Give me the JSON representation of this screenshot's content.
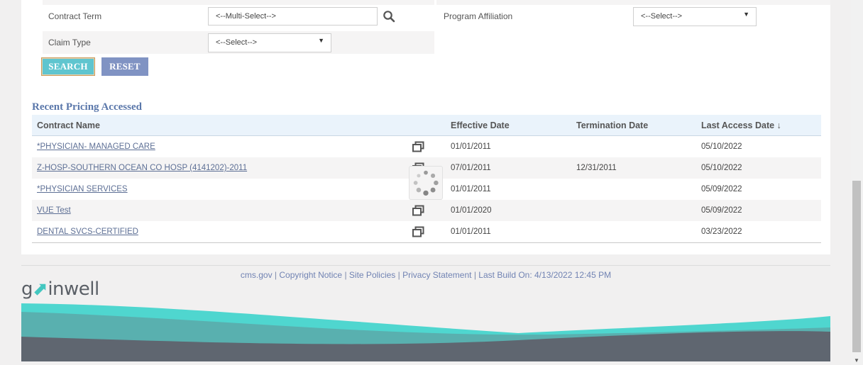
{
  "form": {
    "contract_term_label": "Contract Term",
    "contract_term_placeholder": "<--Multi-Select-->",
    "program_affiliation_label": "Program Affiliation",
    "program_affiliation_value": "<--Select-->",
    "claim_type_label": "Claim Type",
    "claim_type_value": "<--Select-->",
    "search_button": "SEARCH",
    "reset_button": "RESET"
  },
  "recent": {
    "title": "Recent Pricing Accessed",
    "headers": {
      "contract_name": "Contract Name",
      "effective_date": "Effective Date",
      "termination_date": "Termination Date",
      "last_access_date": "Last Access Date ↓"
    },
    "rows": [
      {
        "contract_name": "*PHYSICIAN- MANAGED CARE",
        "effective_date": "01/01/2011",
        "termination_date": "",
        "last_access_date": "05/10/2022"
      },
      {
        "contract_name": "Z-HOSP-SOUTHERN OCEAN CO HOSP (4141202)-2011",
        "effective_date": "07/01/2011",
        "termination_date": "12/31/2011",
        "last_access_date": "05/10/2022"
      },
      {
        "contract_name": "*PHYSICIAN SERVICES",
        "effective_date": "01/01/2011",
        "termination_date": "",
        "last_access_date": "05/09/2022"
      },
      {
        "contract_name": "VUE Test",
        "effective_date": "01/01/2020",
        "termination_date": "",
        "last_access_date": "05/09/2022"
      },
      {
        "contract_name": "DENTAL SVCS-CERTIFIED",
        "effective_date": "01/01/2011",
        "termination_date": "",
        "last_access_date": "03/23/2022"
      }
    ]
  },
  "footer": {
    "links": [
      "cms.gov",
      "Copyright Notice",
      "Site Policies",
      "Privacy Statement"
    ],
    "separator": "|",
    "build_info": "Last Build On: 4/13/2022 12:45 PM"
  },
  "logo": {
    "text": "gainwell",
    "prefix": "g",
    "accent": "ⅎ",
    "suffix": "inwell"
  },
  "icons": {
    "search": "search-icon",
    "copy": "open-in-new-window-icon",
    "loading": "loading-spinner-icon"
  },
  "colors": {
    "search_button": "#5fc5cf",
    "reset_button": "#8093c3",
    "section_title": "#5a77aa",
    "wave_teal": "#43c7c0",
    "wave_gray": "#5f6670"
  }
}
